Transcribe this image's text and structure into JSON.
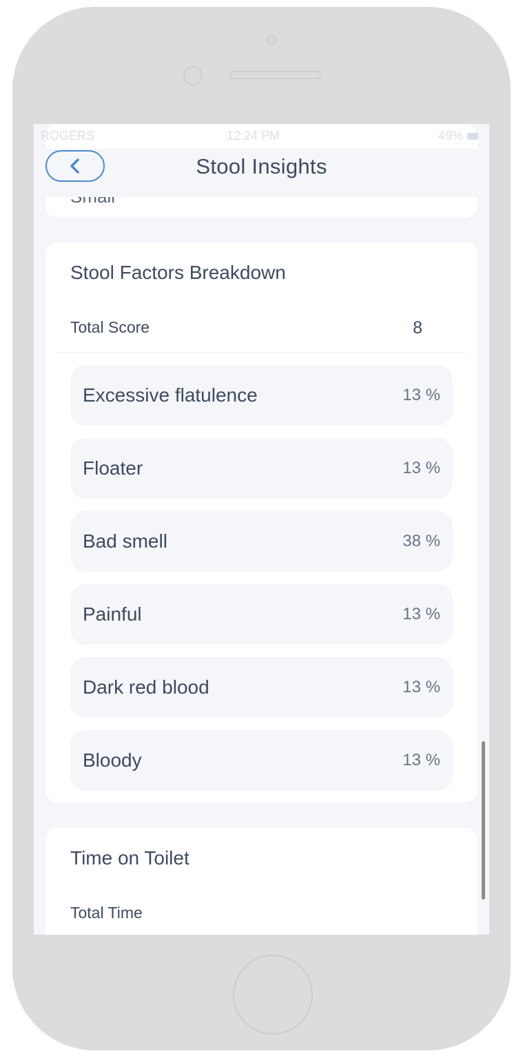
{
  "status_bar": {
    "carrier": "ROGERS",
    "time": "12:24 PM",
    "battery": "49%"
  },
  "header": {
    "title": "Stool Insights"
  },
  "previous_card": {
    "visible_text": "Small"
  },
  "breakdown": {
    "title": "Stool Factors Breakdown",
    "total_label": "Total Score",
    "total_value": "8",
    "factors": [
      {
        "label": "Excessive flatulence",
        "value": "13 %"
      },
      {
        "label": "Floater",
        "value": "13 %"
      },
      {
        "label": "Bad smell",
        "value": "38 %"
      },
      {
        "label": "Painful",
        "value": "13 %"
      },
      {
        "label": "Dark red blood",
        "value": "13 %"
      },
      {
        "label": "Bloody",
        "value": "13 %"
      }
    ]
  },
  "time_on_toilet": {
    "title": "Time on Toilet",
    "total_label": "Total Time"
  },
  "colors": {
    "accent": "#4a8ad0",
    "text": "#3f4a60",
    "screen_bg": "#f4f6fa",
    "card_bg": "#ffffff",
    "bezel": "#dcdcdc"
  }
}
